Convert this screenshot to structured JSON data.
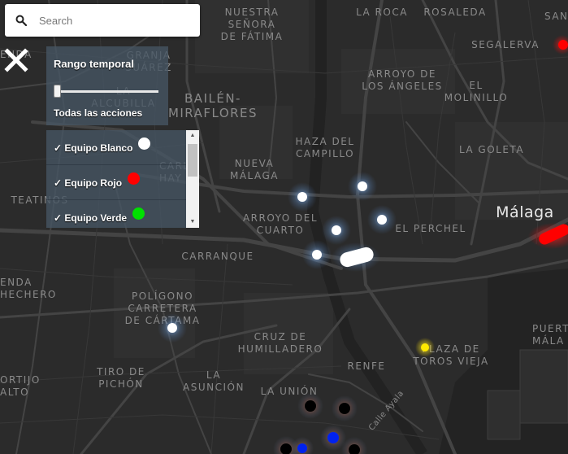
{
  "search": {
    "placeholder": "Search"
  },
  "time_panel": {
    "title": "Rango temporal",
    "slider_label": "Todas las acciones",
    "slider_position": 0
  },
  "teams_panel": {
    "items": [
      {
        "check": "✓",
        "label": "Equipo Blanco",
        "color": "#ffffff"
      },
      {
        "check": "✓",
        "label": "Equipo Rojo",
        "color": "#ff0000"
      },
      {
        "check": "✓",
        "label": "Equipo Verde",
        "color": "#00e000"
      }
    ]
  },
  "map_labels": [
    {
      "name": "map-label-nuestra-senora",
      "lines": [
        "NUESTRA",
        "SEÑORA",
        "DE FÁTIMA"
      ]
    },
    {
      "name": "map-label-la-roca",
      "lines": [
        "LA ROCA"
      ]
    },
    {
      "name": "map-label-rosaleda",
      "lines": [
        "ROSALEDA"
      ]
    },
    {
      "name": "map-label-san-mi",
      "lines": [
        "SAN MI"
      ]
    },
    {
      "name": "map-label-segalerva",
      "lines": [
        "SEGALERVA"
      ]
    },
    {
      "name": "map-label-granja-suarez",
      "lines": [
        "GRANJA",
        "SUÁREZ"
      ]
    },
    {
      "name": "map-label-la-alcubilla",
      "lines": [
        "LA",
        "ALCUBILLA"
      ]
    },
    {
      "name": "map-label-bailen-miraflores",
      "lines": [
        "BAILÉN-",
        "MIRAFLORES"
      ]
    },
    {
      "name": "map-label-arroyo-angeles",
      "lines": [
        "ARROYO DE",
        "LOS ÁNGELES"
      ]
    },
    {
      "name": "map-label-el-molinillo",
      "lines": [
        "EL",
        "MOLINILLO"
      ]
    },
    {
      "name": "map-label-haza-campillo",
      "lines": [
        "HAZA DEL",
        "CAMPILLO"
      ]
    },
    {
      "name": "map-label-la-goleta",
      "lines": [
        "LA GOLETA"
      ]
    },
    {
      "name": "map-label-nueva-malaga",
      "lines": [
        "NUEVA",
        "MÁLAGA"
      ]
    },
    {
      "name": "map-label-carlos-haya",
      "lines": [
        "CARL",
        "HAY"
      ]
    },
    {
      "name": "map-label-malaga",
      "lines": [
        "Málaga"
      ]
    },
    {
      "name": "map-label-teatinos",
      "lines": [
        "TEATINOS"
      ]
    },
    {
      "name": "map-label-arroyo-cuarto",
      "lines": [
        "ARROYO DEL",
        "CUARTO"
      ]
    },
    {
      "name": "map-label-el-perchel",
      "lines": [
        "EL PERCHEL"
      ]
    },
    {
      "name": "map-label-carranque",
      "lines": [
        "CARRANQUE"
      ]
    },
    {
      "name": "map-label-enda-hechero",
      "lines": [
        "ENDA",
        "HECHERO"
      ]
    },
    {
      "name": "map-label-poligono",
      "lines": [
        "POLÍGONO",
        "CARRETERA",
        "DE CÁRTAMA"
      ]
    },
    {
      "name": "map-label-cruz-humilladero",
      "lines": [
        "CRUZ DE",
        "HUMILLADERO"
      ]
    },
    {
      "name": "map-label-plaza-toros",
      "lines": [
        "PLAZA DE",
        "TOROS VIEJA"
      ]
    },
    {
      "name": "map-label-puerto-malaga",
      "lines": [
        "PUERT",
        "MÁLA"
      ]
    },
    {
      "name": "map-label-renfe",
      "lines": [
        "RENFE"
      ]
    },
    {
      "name": "map-label-tiro-pichon",
      "lines": [
        "TIRO DE",
        "PICHÓN"
      ]
    },
    {
      "name": "map-label-la-asuncion",
      "lines": [
        "LA",
        "ASUNCIÓN"
      ]
    },
    {
      "name": "map-label-portijo-alto",
      "lines": [
        "ORTIJO",
        "ALTO"
      ]
    },
    {
      "name": "map-label-la-union",
      "lines": [
        "LA UNIÓN"
      ]
    },
    {
      "name": "map-label-calle-ayala",
      "lines": [
        "Calle Ayala"
      ]
    },
    {
      "name": "map-label-cortijo",
      "lines": [
        "CORTIJO"
      ]
    },
    {
      "name": "map-label-enda",
      "lines": [
        "ENDA"
      ]
    }
  ]
}
